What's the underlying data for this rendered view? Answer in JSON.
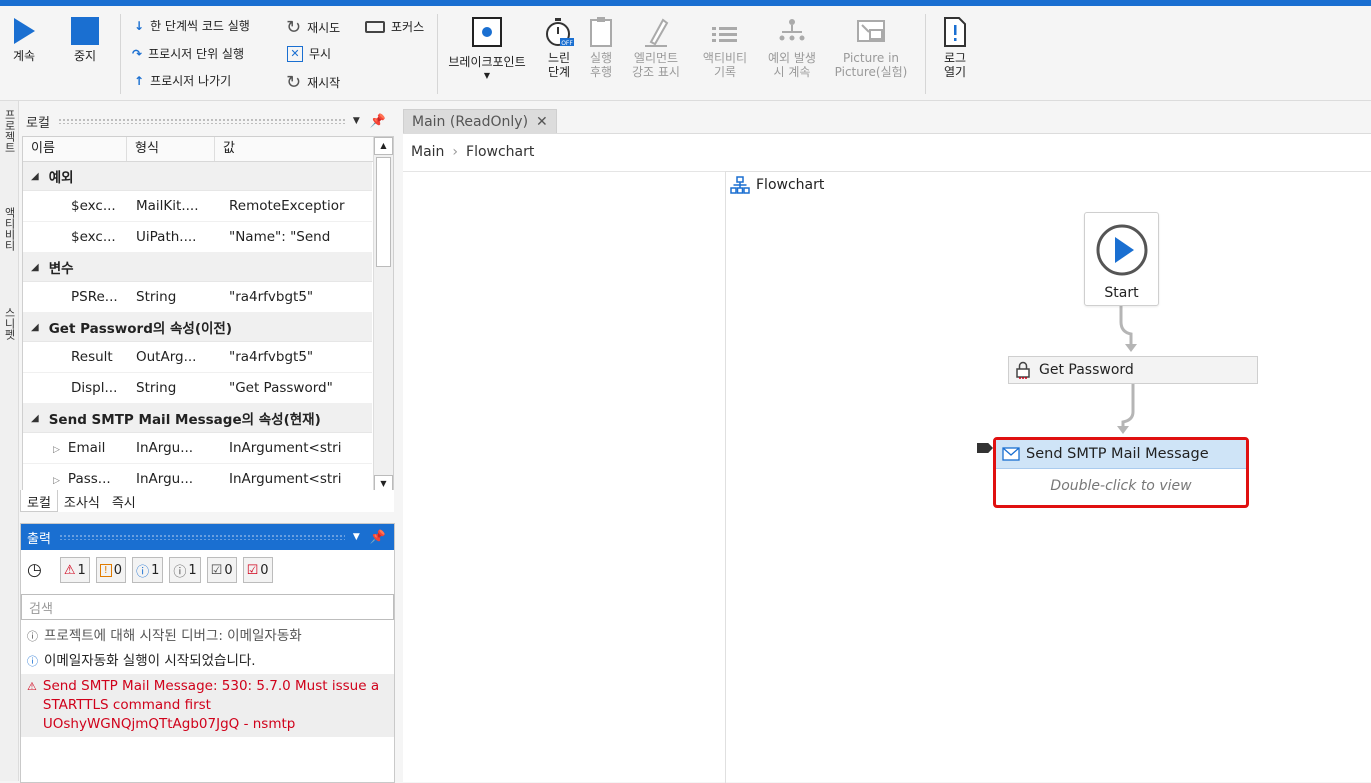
{
  "ribbon": {
    "continue_label": "계속",
    "stop_label": "중지",
    "step_into": "한 단계씩 코드 실행",
    "step_over": "프로시저 단위 실행",
    "step_out": "프로시저 나가기",
    "retry": "재시도",
    "ignore": "무시",
    "restart": "재시작",
    "focus": "포커스",
    "breakpoints": "브레이크포인트",
    "slow_step": [
      "느린",
      "단계"
    ],
    "execution_trail": [
      "실행",
      "후행"
    ],
    "highlight_elements": [
      "엘리먼트",
      "강조 표시"
    ],
    "log_activities": [
      "액티비티",
      "기록"
    ],
    "continue_on_exception": [
      "예외 발생",
      "시 계속"
    ],
    "picture_in_picture": [
      "Picture in",
      "Picture(실험)"
    ],
    "open_logs": [
      "로그",
      "열기"
    ]
  },
  "left_tabs": [
    "프로젝트",
    "액티비티",
    "스니펫"
  ],
  "locals": {
    "title": "로컬",
    "columns": [
      "이름",
      "형식",
      "값"
    ],
    "groups": [
      {
        "name": "예외",
        "rows": [
          {
            "name": "$exc...",
            "type": "MailKit....",
            "value": "RemoteExceptior"
          },
          {
            "name": "$exc...",
            "type": "UiPath....",
            "value": " \"Name\": \"Send"
          }
        ]
      },
      {
        "name": "변수",
        "rows": [
          {
            "name": "PSRe...",
            "type": "String",
            "value": "\"ra4rfvbgt5\""
          }
        ]
      },
      {
        "name": "Get Password의 속성(이전)",
        "rows": [
          {
            "name": "Result",
            "type": "OutArg...",
            "value": "\"ra4rfvbgt5\""
          },
          {
            "name": "Displ...",
            "type": "String",
            "value": "\"Get Password\""
          }
        ]
      },
      {
        "name": "Send SMTP Mail Message의 속성(현재)",
        "rows": [
          {
            "name": "Email",
            "type": "InArgu...",
            "value": "InArgument<stri"
          },
          {
            "name": "Pass...",
            "type": "InArgu...",
            "value": "InArgument<stri"
          }
        ]
      }
    ],
    "bottom_tabs": [
      "로컬",
      "조사식",
      "즉시"
    ]
  },
  "output": {
    "title": "출력",
    "filters": [
      {
        "icon": "error-icon",
        "count": "1"
      },
      {
        "icon": "warning-icon",
        "count": "0"
      },
      {
        "icon": "info-icon",
        "count": "1"
      },
      {
        "icon": "trace-icon",
        "count": "1"
      },
      {
        "icon": "verbose-icon",
        "count": "0"
      },
      {
        "icon": "fatal-icon",
        "count": "0"
      }
    ],
    "search_placeholder": "검색",
    "logs": [
      {
        "level": "trace",
        "text": "프로젝트에 대해 시작된 디버그: 이메일자동화"
      },
      {
        "level": "info",
        "text": "이메일자동화 실행이 시작되었습니다."
      },
      {
        "level": "error",
        "text": "Send SMTP Mail Message: 530: 5.7.0 Must issue a STARTTLS command first UOshyWGNQjmQTtAgb07JgQ - nsmtp"
      }
    ]
  },
  "document": {
    "tab_label": "Main (ReadOnly)",
    "breadcrumb": [
      "Main",
      "Flowchart"
    ],
    "flowchart_title": "Flowchart",
    "start_label": "Start",
    "get_password_label": "Get Password",
    "send_label": "Send SMTP Mail Message",
    "send_hint": "Double-click to view"
  },
  "colors": {
    "accent": "#1a6fd1",
    "error": "#d0021b",
    "highlight_border": "#e01010",
    "selected_activity": "#cfe4f7"
  }
}
